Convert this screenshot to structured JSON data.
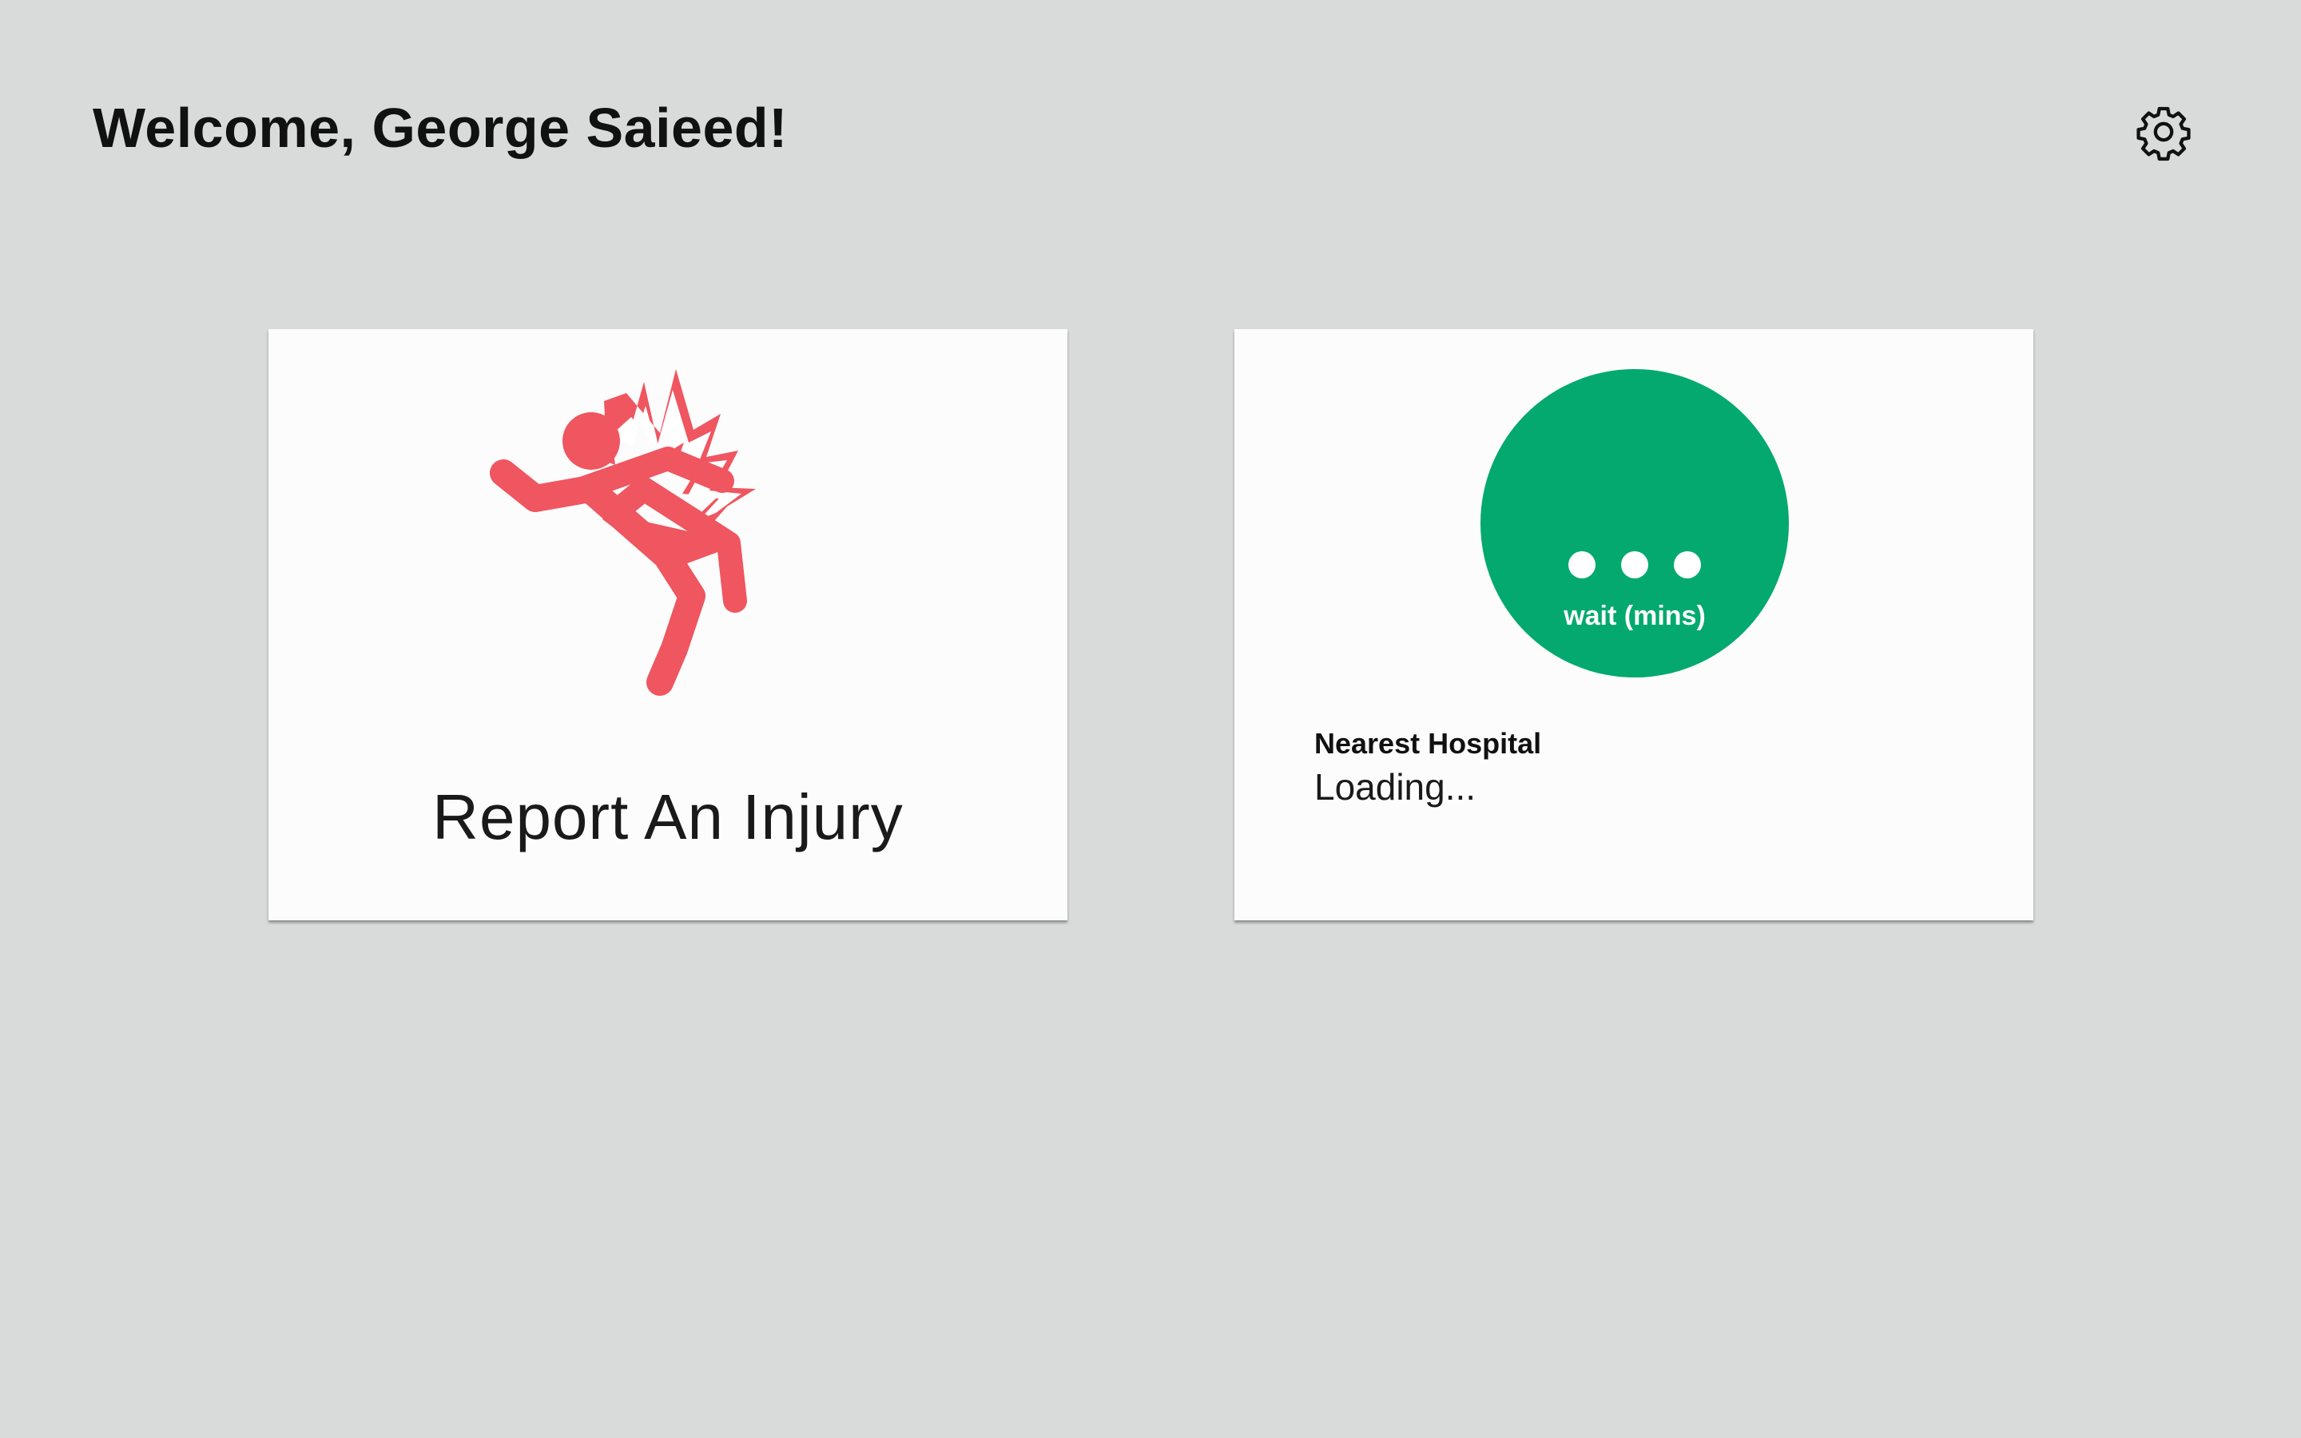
{
  "header": {
    "welcome_text": "Welcome, George Saieed!",
    "settings_icon": "gear-icon"
  },
  "report_card": {
    "icon": "injured-person-icon",
    "label": "Report An Injury",
    "accent_color": "#ef5660"
  },
  "hospital_card": {
    "wait_value": "• • •",
    "wait_label": "wait (mins)",
    "heading": "Nearest Hospital",
    "status": "Loading...",
    "accent_color": "#03a96f"
  }
}
